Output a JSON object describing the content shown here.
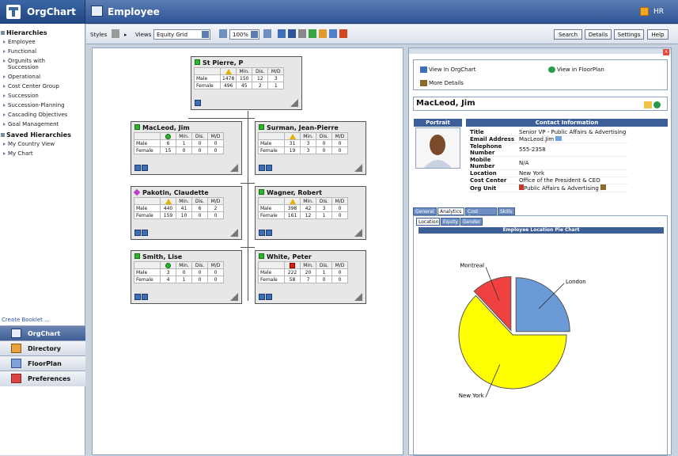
{
  "app": {
    "logo": "OrgChart",
    "page_title": "Employee",
    "user": "HR"
  },
  "sidebar": {
    "sections": [
      {
        "title": "Hierarchies",
        "items": [
          "Employee",
          "Functional",
          "Orgunits with Succession",
          "Operational",
          "Cost Center Group",
          "Succession",
          "Succession-Planning",
          "Cascading Objectives",
          "Goal Management"
        ]
      },
      {
        "title": "Saved Hierarchies",
        "items": [
          "My Country View",
          "My Chart"
        ]
      }
    ],
    "create_booklet": "Create Booklet ...",
    "nav": [
      "OrgChart",
      "Directory",
      "FloorPlan",
      "Preferences"
    ]
  },
  "toolbar": {
    "styles_label": "Styles",
    "views_label": "Views",
    "view_value": "Equity Grid",
    "zoom": "100%",
    "buttons": [
      "Search",
      "Details",
      "Settings",
      "Help"
    ]
  },
  "table_headers": [
    "",
    "Min.",
    "Dis.",
    "M/D"
  ],
  "row_labels": [
    "Male",
    "Female"
  ],
  "cards": [
    {
      "name": "St Pierre, P",
      "indicator": "triangle",
      "male": [
        "1478",
        "150",
        "12",
        "3"
      ],
      "female": [
        "496",
        "45",
        "2",
        "1"
      ]
    },
    {
      "name": "MacLeod, Jim",
      "indicator": "circle",
      "male": [
        "6",
        "1",
        "0",
        "0"
      ],
      "female": [
        "15",
        "0",
        "0",
        "0"
      ]
    },
    {
      "name": "Surman, Jean-Pierre",
      "indicator": "triangle",
      "male": [
        "31",
        "3",
        "0",
        "0"
      ],
      "female": [
        "19",
        "3",
        "0",
        "0"
      ]
    },
    {
      "name": "Pakotin, Claudette",
      "indicator": "triangle",
      "male": [
        "440",
        "41",
        "6",
        "2"
      ],
      "female": [
        "159",
        "10",
        "0",
        "0"
      ]
    },
    {
      "name": "Wagner, Robert",
      "indicator": "triangle",
      "male": [
        "398",
        "42",
        "3",
        "0"
      ],
      "female": [
        "161",
        "12",
        "1",
        "0"
      ]
    },
    {
      "name": "Smith, Lise",
      "indicator": "circle",
      "male": [
        "3",
        "0",
        "0",
        "0"
      ],
      "female": [
        "4",
        "1",
        "0",
        "0"
      ]
    },
    {
      "name": "White, Peter",
      "indicator": "square-red",
      "male": [
        "222",
        "20",
        "1",
        "0"
      ],
      "female": [
        "58",
        "7",
        "0",
        "0"
      ]
    }
  ],
  "detail": {
    "links": [
      "View In OrgChart",
      "View in FloorPlan",
      "More Details"
    ],
    "name": "MacLeod, Jim",
    "portrait_label": "Portrait",
    "contact_label": "Contact Information",
    "contact": [
      [
        "Title",
        "Senior VP - Public Affairs & Advertising"
      ],
      [
        "Email Address",
        "MacLeod.Jim"
      ],
      [
        "Telephone Number",
        "555-2358"
      ],
      [
        "Mobile Number",
        "N/A"
      ],
      [
        "Location",
        "New York"
      ],
      [
        "Cost Center",
        "Office of the President & CEO"
      ],
      [
        "Org Unit",
        "Public Affairs & Advertising"
      ]
    ],
    "tabs": [
      "General",
      "Analytics",
      "Cost Center",
      "Skills"
    ],
    "subtabs": [
      "Location",
      "Equity",
      "Gender"
    ]
  },
  "chart_data": {
    "type": "pie",
    "title": "Employee Location Pie Chart",
    "categories": [
      "London",
      "New York",
      "Montreal"
    ],
    "values": [
      25,
      63,
      12
    ],
    "colors": [
      "#6a9bd6",
      "#ffff00",
      "#f04040"
    ]
  }
}
